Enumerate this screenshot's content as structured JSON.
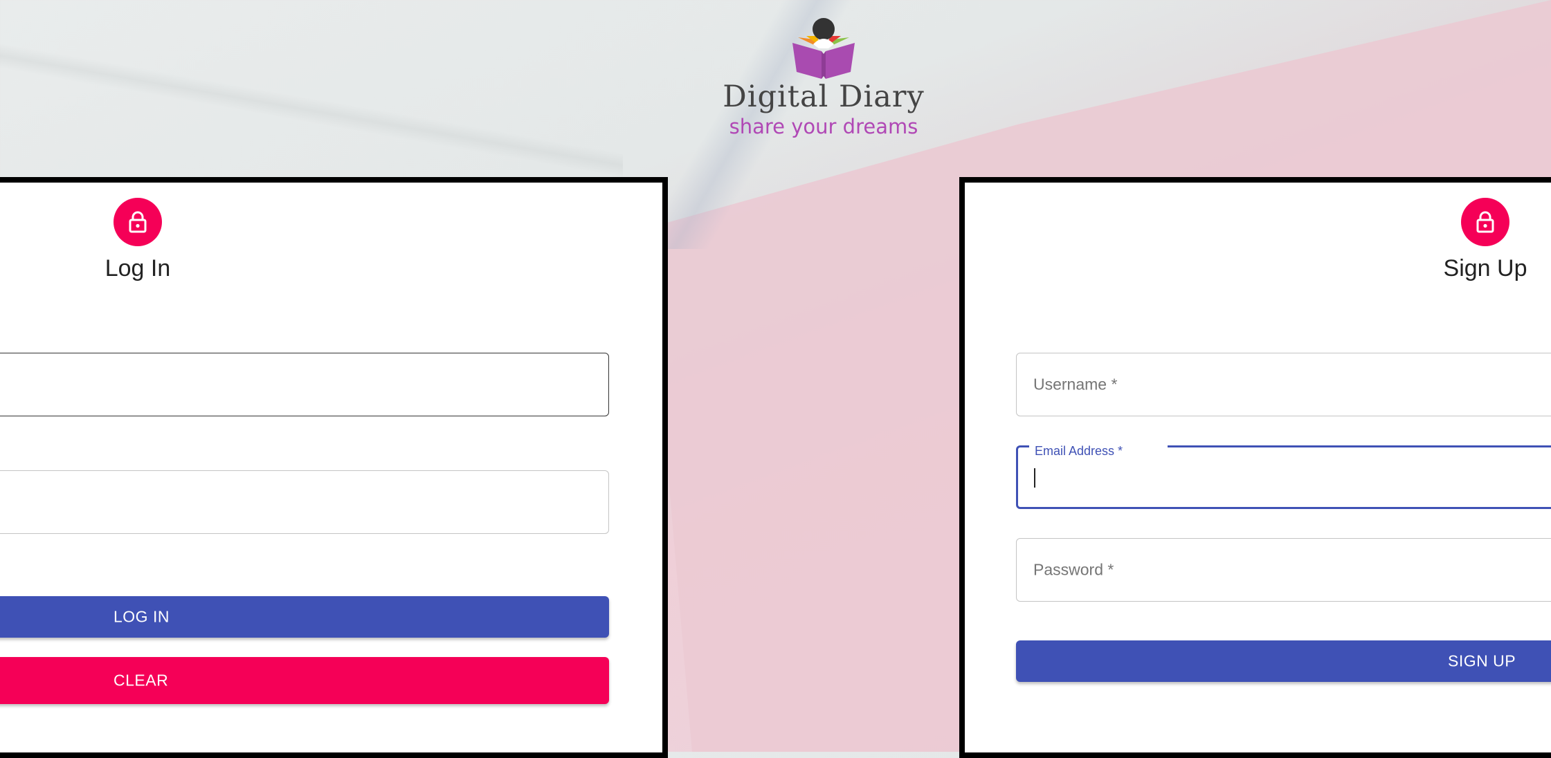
{
  "brand": {
    "title": "Digital Diary",
    "tagline": "share your dreams",
    "logo_icon": "reader-on-book-icon"
  },
  "login": {
    "title": "Log In",
    "icon": "lock-icon",
    "login_button": "LOG IN",
    "clear_button": "CLEAR"
  },
  "signup": {
    "title": "Sign Up",
    "icon": "lock-icon",
    "username_label": "Username *",
    "email_label": "Email Address *",
    "password_label": "Password *",
    "signup_button": "SIGN UP"
  },
  "colors": {
    "primary": "#3f51b5",
    "secondary": "#f50057",
    "tagline": "#b048b5"
  }
}
